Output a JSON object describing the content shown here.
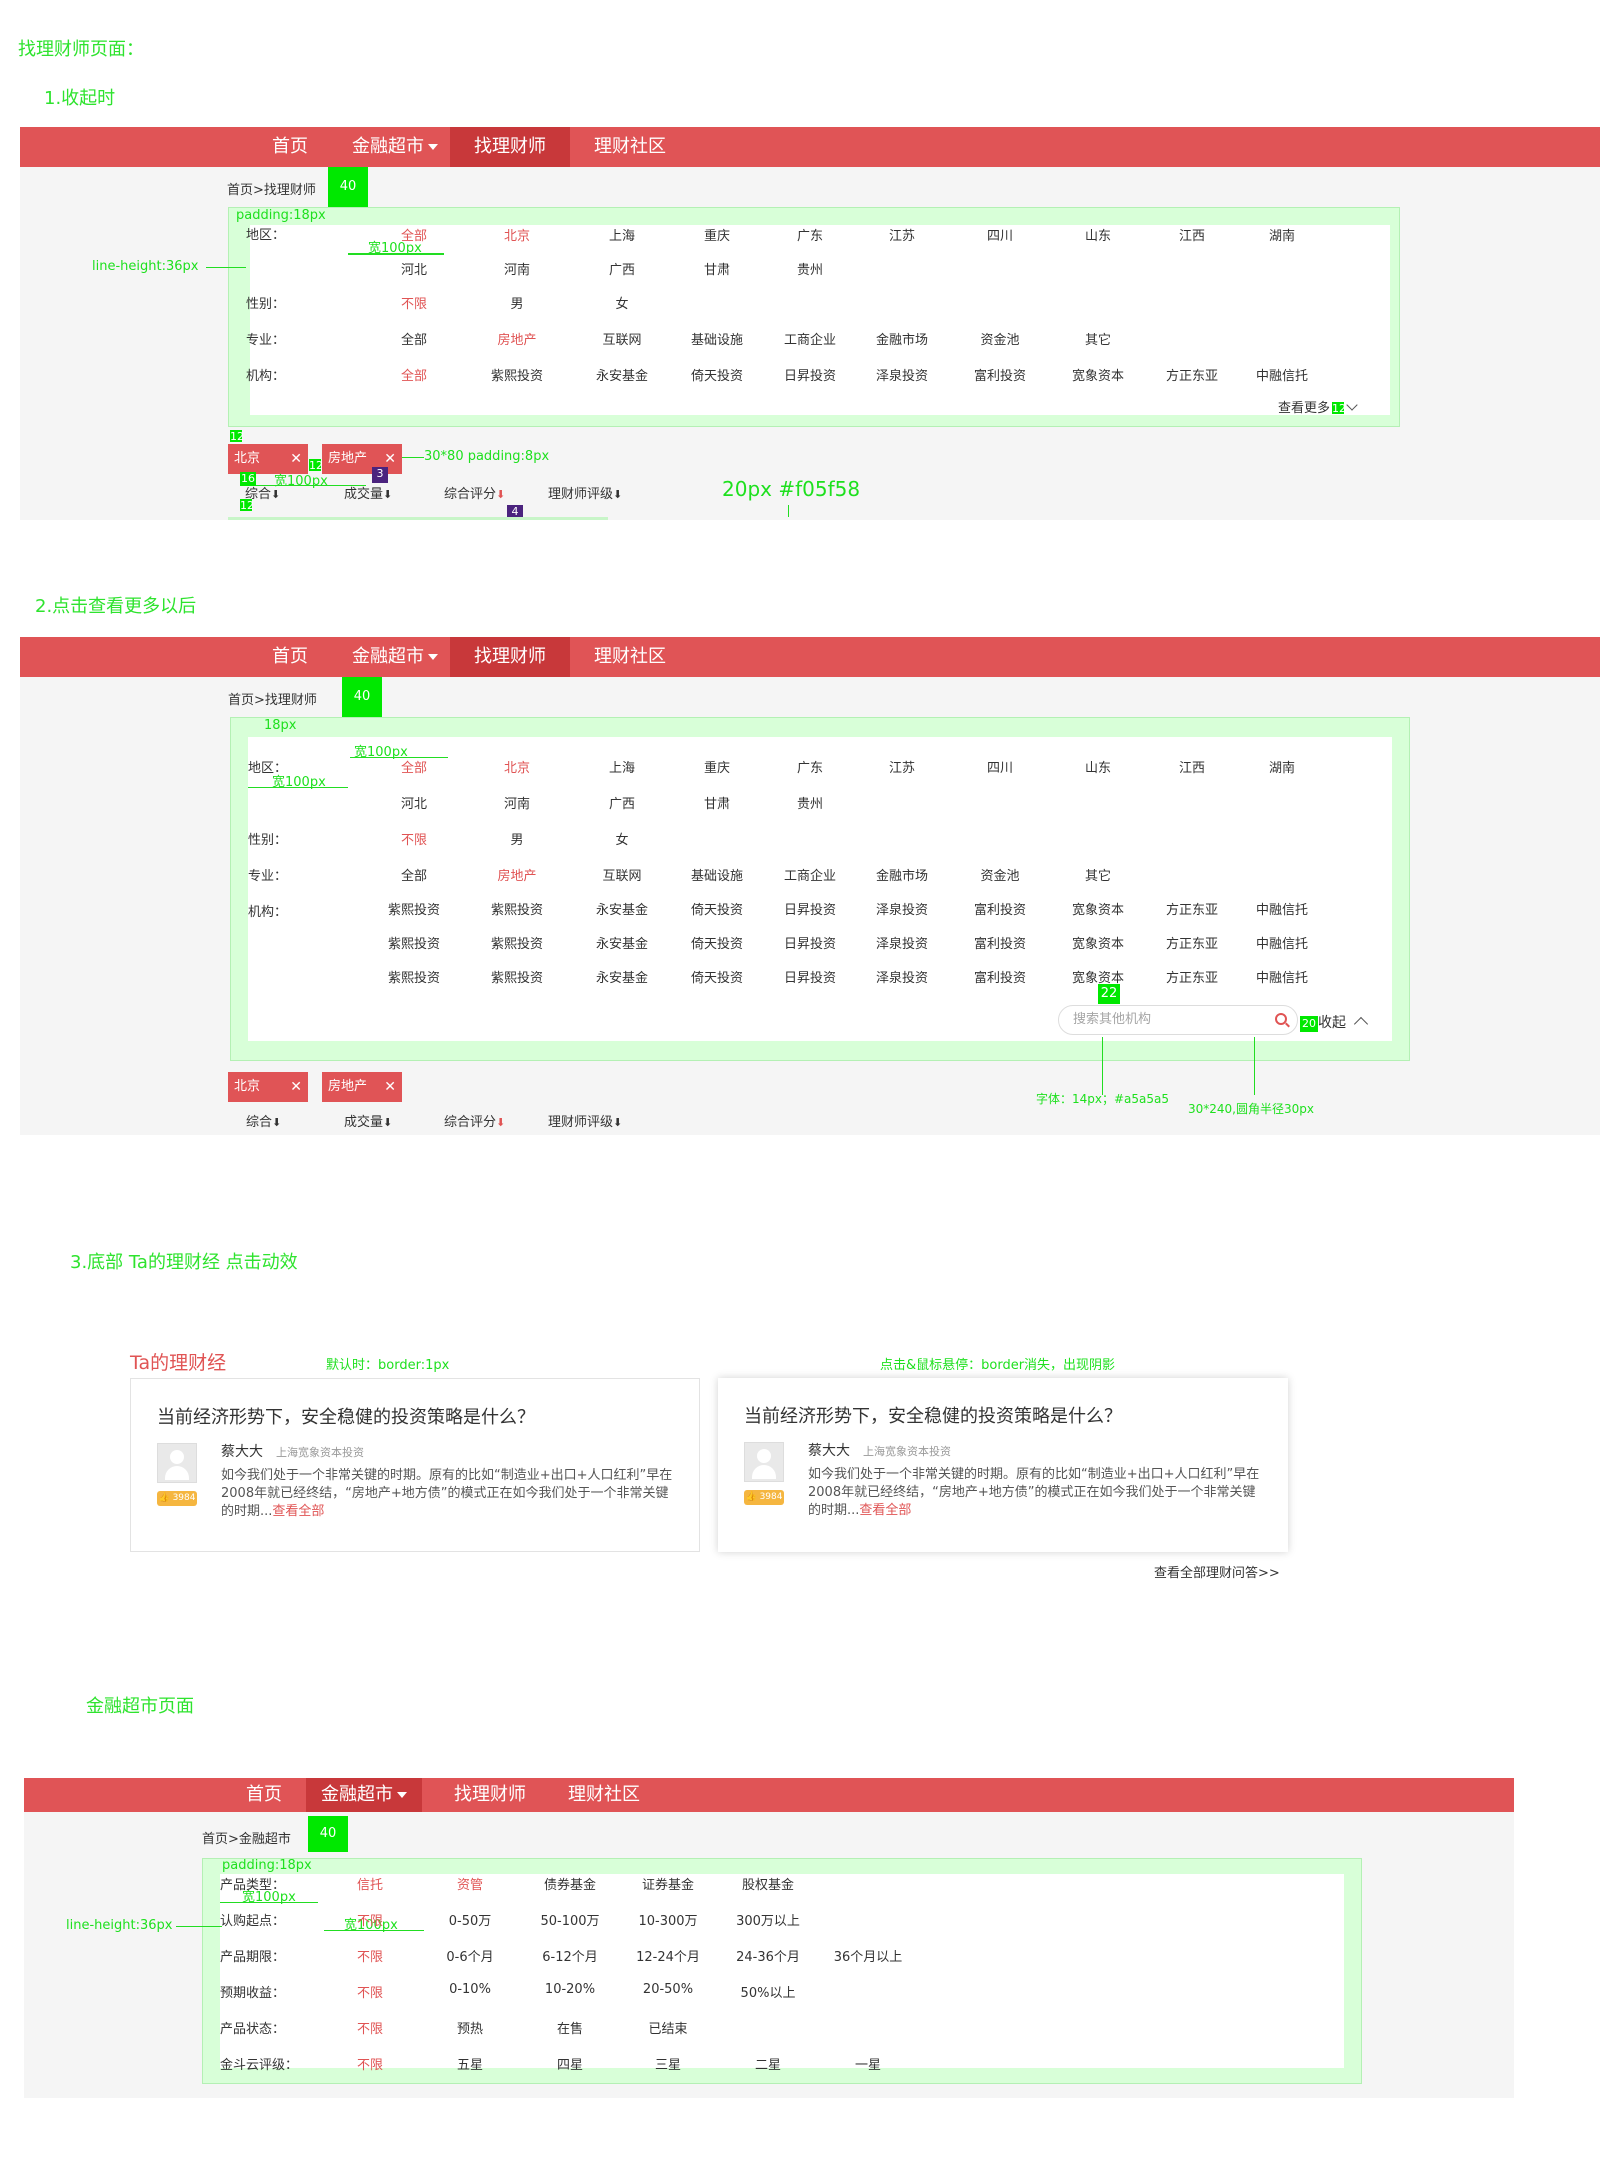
{
  "page_heading": "找理财师页面：",
  "section1_heading": "1.收起时",
  "section2_heading": "2.点击查看更多以后",
  "section3_heading": "3.底部 Ta的理财经 点击动效",
  "section4_heading": "金融超市页面",
  "nav": {
    "home": "首页",
    "market": "金融超市",
    "advisor": "找理财师",
    "community": "理财社区"
  },
  "breadcrumb_advisor": "首页>找理财师",
  "breadcrumb_market": "首页>金融超市",
  "badge_40": "40",
  "filters": {
    "region_label": "地区：",
    "gender_label": "性别：",
    "major_label": "专业：",
    "org_label": "机构：",
    "region_row1": [
      "全部",
      "北京",
      "上海",
      "重庆",
      "广东",
      "江苏",
      "四川",
      "山东",
      "江西",
      "湖南"
    ],
    "region_row2": [
      "河北",
      "河南",
      "广西",
      "甘肃",
      "贵州"
    ],
    "gender": [
      "不限",
      "男",
      "女"
    ],
    "major": [
      "全部",
      "房地产",
      "互联网",
      "基础设施",
      "工商企业",
      "金融市场",
      "资金池",
      "其它"
    ],
    "org_row_collapsed": [
      "全部",
      "紫熙投资",
      "永安基金",
      "倚天投资",
      "日昇投资",
      "泽泉投资",
      "富利投资",
      "宽象资本",
      "方正东亚",
      "中融信托"
    ],
    "org_row_expanded": [
      "紫熙投资",
      "紫熙投资",
      "永安基金",
      "倚天投资",
      "日昇投资",
      "泽泉投资",
      "富利投资",
      "宽象资本",
      "方正东亚",
      "中融信托"
    ],
    "see_more": "查看更多",
    "collapse": "收起",
    "search_placeholder": "搜索其他机构"
  },
  "chips": {
    "chip1": "北京",
    "chip2": "房地产",
    "close": "✕"
  },
  "sort": {
    "s1": "综合",
    "s2": "成交量",
    "s3": "综合评分",
    "s4": "理财师评级",
    "down": "⬇"
  },
  "annotations": {
    "padding18": "padding:18px",
    "width100": "宽100px",
    "line_height": "line-height:36px",
    "chip_size": "30*80 padding:8px",
    "color_note": "20px #f05f58",
    "px18": "18px",
    "font_note": "字体：14px；#a5a5a5",
    "radius_note": "30*240,圆角半径30px",
    "n12": "12",
    "n16": "16",
    "n3": "3",
    "n4": "4",
    "n20": "20",
    "n22": "22",
    "default_border": "默认时：border:1px",
    "hover_note": "点击&鼠标悬停：border消失，出现阴影"
  },
  "ta_section": {
    "title": "Ta的理财经",
    "card_title": "当前经济形势下，安全稳健的投资策略是什么？",
    "author": "蔡大大",
    "org": "上海宽象资本投资",
    "likes": "👍 3984",
    "body": "如今我们处于一个非常关键的时期。原有的比如“制造业+出口+人口红利”早在2008年就已经终结，“房地产+地方债”的模式正在如今我们处于一个非常关键的时期...",
    "more": "查看全部",
    "view_all": "查看全部理财问答>>"
  },
  "market_filters": {
    "type_label": "产品类型：",
    "start_label": "认购起点：",
    "term_label": "产品期限：",
    "yield_label": "预期收益：",
    "status_label": "产品状态：",
    "rating_label": "金斗云评级：",
    "types": [
      "信托",
      "资管",
      "债券基金",
      "证券基金",
      "股权基金"
    ],
    "start": [
      "不限",
      "0-50万",
      "50-100万",
      "10-300万",
      "300万以上"
    ],
    "term": [
      "不限",
      "0-6个月",
      "6-12个月",
      "12-24个月",
      "24-36个月",
      "36个月以上"
    ],
    "yield": [
      "不限",
      "0-10%",
      "10-20%",
      "20-50%",
      "50%以上"
    ],
    "status": [
      "不限",
      "预热",
      "在售",
      "已结束"
    ],
    "rating": [
      "不限",
      "五星",
      "四星",
      "三星",
      "二星",
      "一星"
    ]
  },
  "colors": {
    "nav": "#e05456",
    "nav_active": "#c8383a",
    "accent": "#f05f58",
    "annotation": "#1ee01e"
  }
}
